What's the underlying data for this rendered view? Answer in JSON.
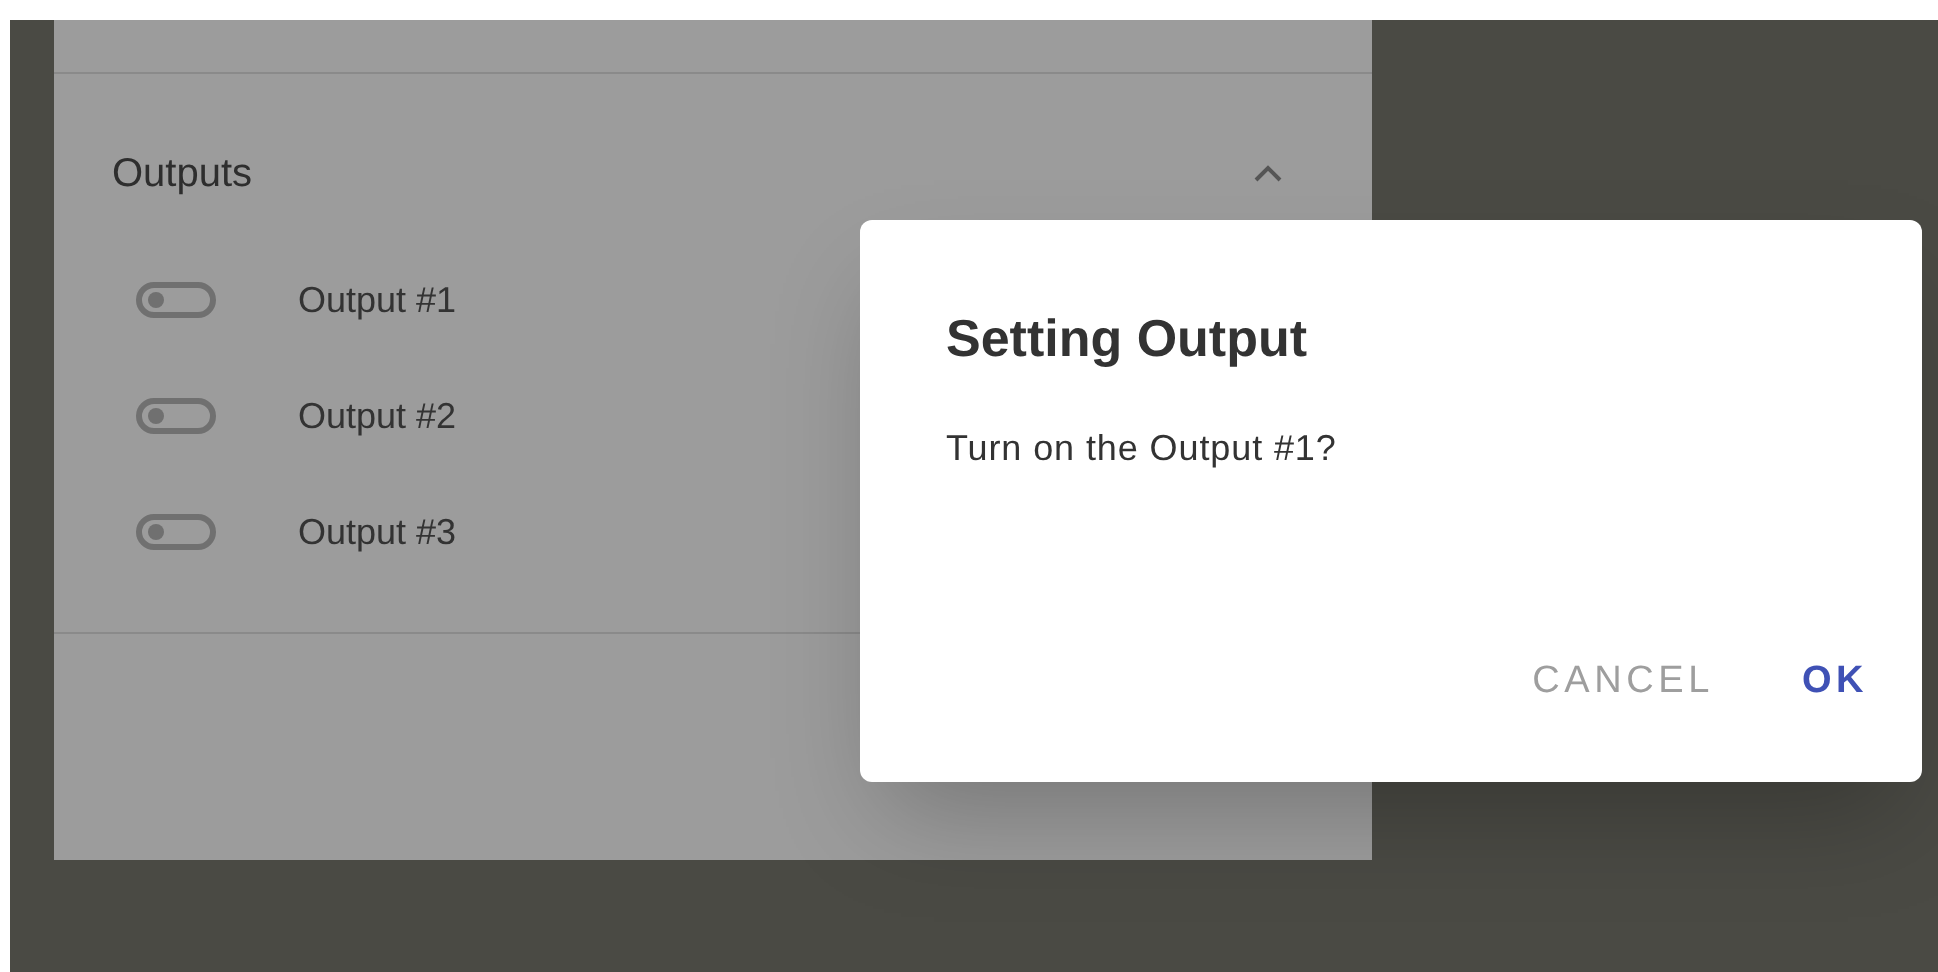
{
  "panel": {
    "title": "Outputs",
    "expanded": true,
    "outputs": [
      {
        "label": "Output #1",
        "on": false
      },
      {
        "label": "Output #2",
        "on": false
      },
      {
        "label": "Output #3",
        "on": false
      }
    ]
  },
  "dialog": {
    "title": "Setting Output",
    "message": "Turn on the Output #1?",
    "buttons": [
      {
        "label": "CANCEL",
        "primary": false
      },
      {
        "label": "OK",
        "primary": true
      }
    ]
  }
}
